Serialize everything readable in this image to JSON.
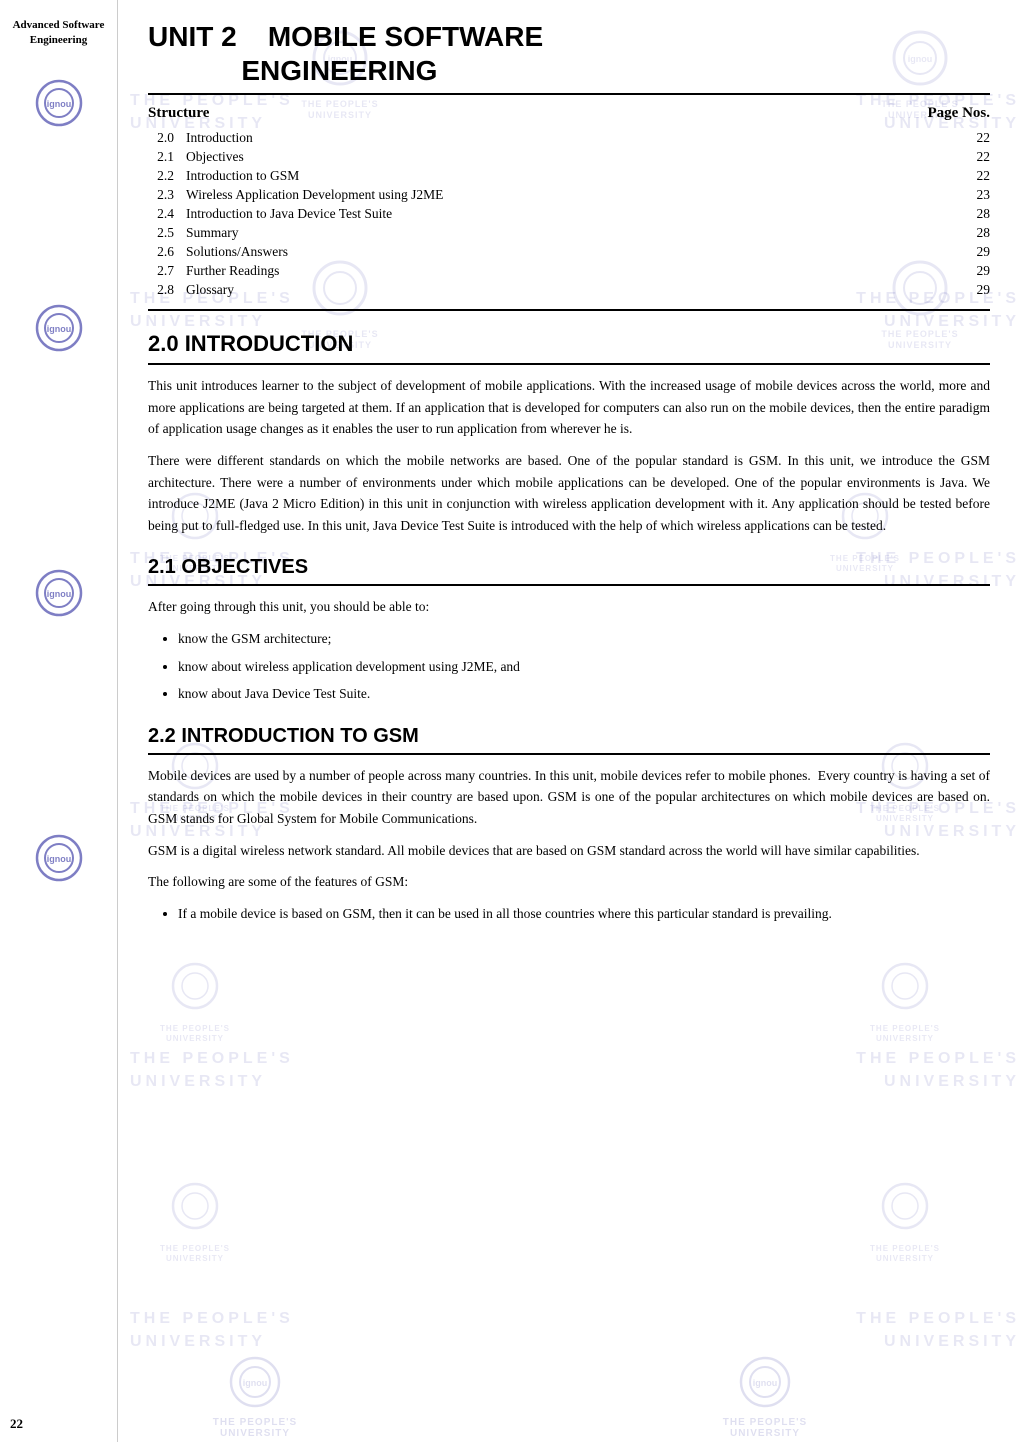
{
  "sidebar": {
    "title": "Advanced Software\nEngineering"
  },
  "unit": {
    "number": "UNIT 2",
    "title": "MOBILE SOFTWARE\nENGINEERING"
  },
  "toc": {
    "structure_label": "Structure",
    "page_nos_label": "Page Nos.",
    "items": [
      {
        "num": "2.0",
        "label": "Introduction",
        "page": "22"
      },
      {
        "num": "2.1",
        "label": "Objectives",
        "page": "22"
      },
      {
        "num": "2.2",
        "label": "Introduction to GSM",
        "page": "22"
      },
      {
        "num": "2.3",
        "label": "Wireless Application Development using J2ME",
        "page": "23"
      },
      {
        "num": "2.4",
        "label": "Introduction to Java Device Test Suite",
        "page": "28"
      },
      {
        "num": "2.5",
        "label": "Summary",
        "page": "28"
      },
      {
        "num": "2.6",
        "label": "Solutions/Answers",
        "page": "29"
      },
      {
        "num": "2.7",
        "label": "Further Readings",
        "page": "29"
      },
      {
        "num": "2.8",
        "label": "Glossary",
        "page": "29"
      }
    ]
  },
  "sections": {
    "intro": {
      "heading": "2.0   INTRODUCTION",
      "paragraphs": [
        "This unit introduces learner to the subject of development of mobile applications. With the increased usage of mobile devices across the world, more and more applications are being targeted at them. If an application that is developed for computers can also run on the mobile devices, then the entire paradigm of application usage changes as it enables the user to run application from wherever he is.",
        "There were different standards on which the mobile networks are based. One of the popular standard is GSM. In this unit, we introduce the GSM architecture. There were a number of environments under which mobile applications can be developed. One of the popular environments is Java. We introduce J2ME (Java 2 Micro Edition) in this unit in conjunction with wireless application development with it. Any application should be tested before being put to full-fledged use. In this unit, Java Device Test Suite is introduced with the help of which wireless applications can be tested."
      ]
    },
    "objectives": {
      "heading": "2.1   OBJECTIVES",
      "intro": "After going through this unit, you should be able to:",
      "items": [
        "know the GSM architecture;",
        "know about wireless application development using J2ME, and",
        "know about Java Device Test Suite."
      ]
    },
    "gsm": {
      "heading": "2.2   INTRODUCTION TO GSM",
      "paragraphs": [
        "Mobile devices are used by a number of people across many countries. In this unit, mobile devices refer to mobile phones.  Every country is having a set of standards on which the mobile devices in their country are based upon. GSM is one of the popular architectures on which mobile devices are based on. GSM stands for Global System for Mobile Communications.",
        "GSM is a digital wireless network standard. All mobile devices that are based on GSM standard across the world will have similar capabilities.",
        "The following are some of the features of GSM:"
      ],
      "gsm_feature": "If a mobile device is based on GSM, then it can be used in all those countries where this particular standard is prevailing."
    }
  },
  "page_number": "22",
  "watermark": {
    "line1": "THE PEOPLE'S",
    "line2": "UNIVERSITY"
  }
}
